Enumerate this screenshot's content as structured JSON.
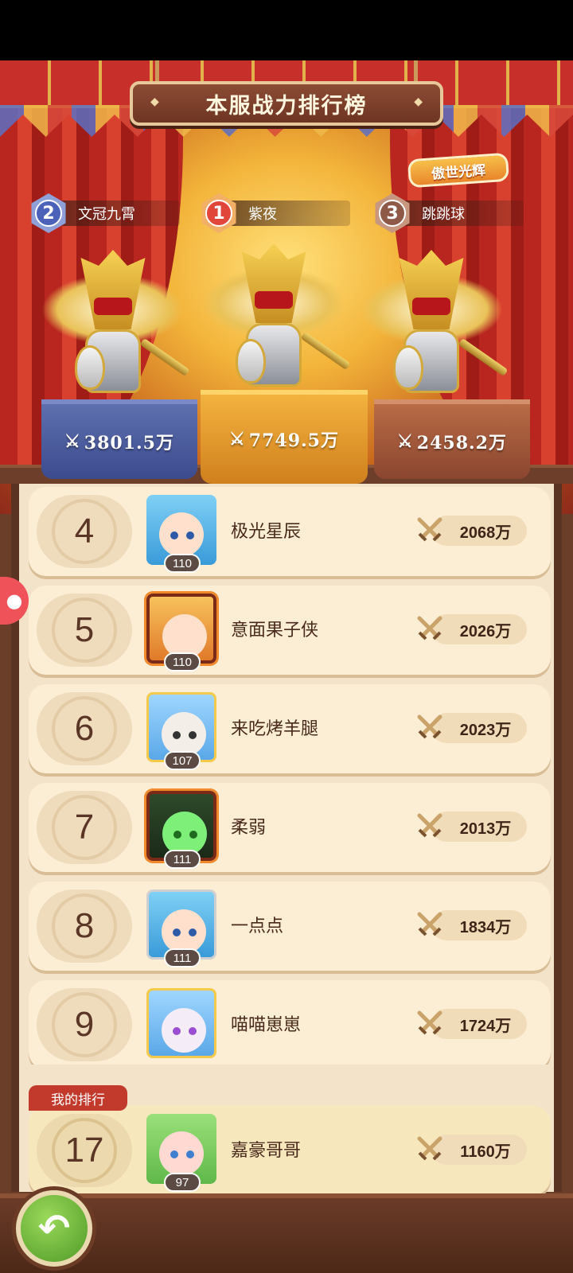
{
  "header": {
    "title": "本服战力排行榜",
    "event_badge": "傲世光辉"
  },
  "top3": [
    {
      "rank": "2",
      "name": "文冠九霄",
      "power": "3801.5万"
    },
    {
      "rank": "1",
      "name": "紫夜",
      "power": "7749.5万"
    },
    {
      "rank": "3",
      "name": "跳跳球",
      "power": "2458.2万"
    }
  ],
  "rows": [
    {
      "rank": "4",
      "name": "极光星辰",
      "level": "110",
      "power": "2068万"
    },
    {
      "rank": "5",
      "name": "意面果子侠",
      "level": "110",
      "power": "2026万"
    },
    {
      "rank": "6",
      "name": "来吃烤羊腿",
      "level": "107",
      "power": "2023万"
    },
    {
      "rank": "7",
      "name": "柔弱",
      "level": "111",
      "power": "2013万"
    },
    {
      "rank": "8",
      "name": "一点点",
      "level": "111",
      "power": "1834万"
    },
    {
      "rank": "9",
      "name": "喵喵崽崽",
      "level": "",
      "power": "1724万"
    }
  ],
  "mine": {
    "tab_label": "我的排行",
    "rank": "17",
    "name": "嘉豪哥哥",
    "level": "97",
    "power": "1160万"
  },
  "colors": {
    "accent_red": "#c23a2c",
    "board": "#f3e4c9",
    "wood": "#5a3322"
  }
}
